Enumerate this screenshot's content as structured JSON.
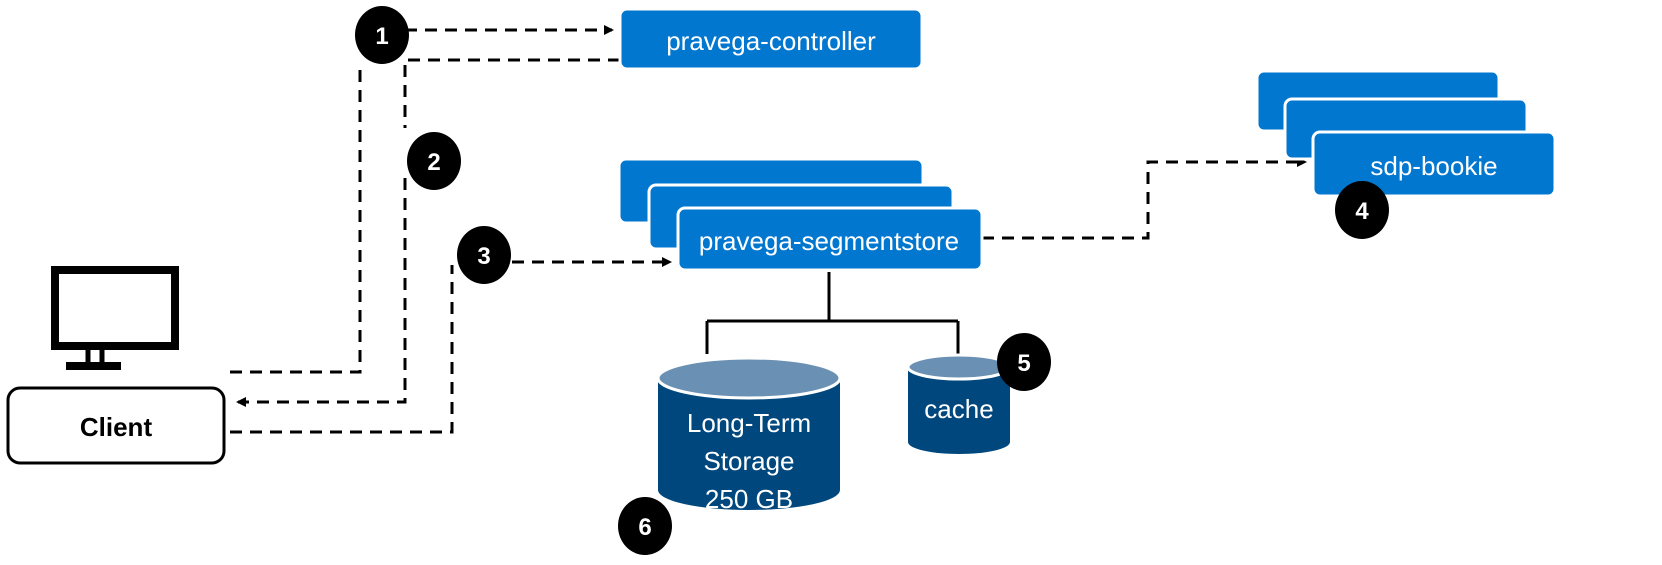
{
  "colors": {
    "component_blue": "#0277cf",
    "storage_body": "#00477e",
    "storage_top": "#6a91b3",
    "badge": "#000000"
  },
  "nodes": {
    "client": {
      "label": "Client",
      "icon": "monitor-icon"
    },
    "controller": {
      "label": "pravega-controller"
    },
    "segmentstore": {
      "label": "pravega-segmentstore"
    },
    "bookie": {
      "label": "sdp-bookie"
    },
    "long_term_storage": {
      "lines": [
        "Long-Term",
        "Storage",
        "250 GB"
      ]
    },
    "cache": {
      "label": "cache"
    }
  },
  "badges": [
    "1",
    "2",
    "3",
    "4",
    "5",
    "6"
  ]
}
